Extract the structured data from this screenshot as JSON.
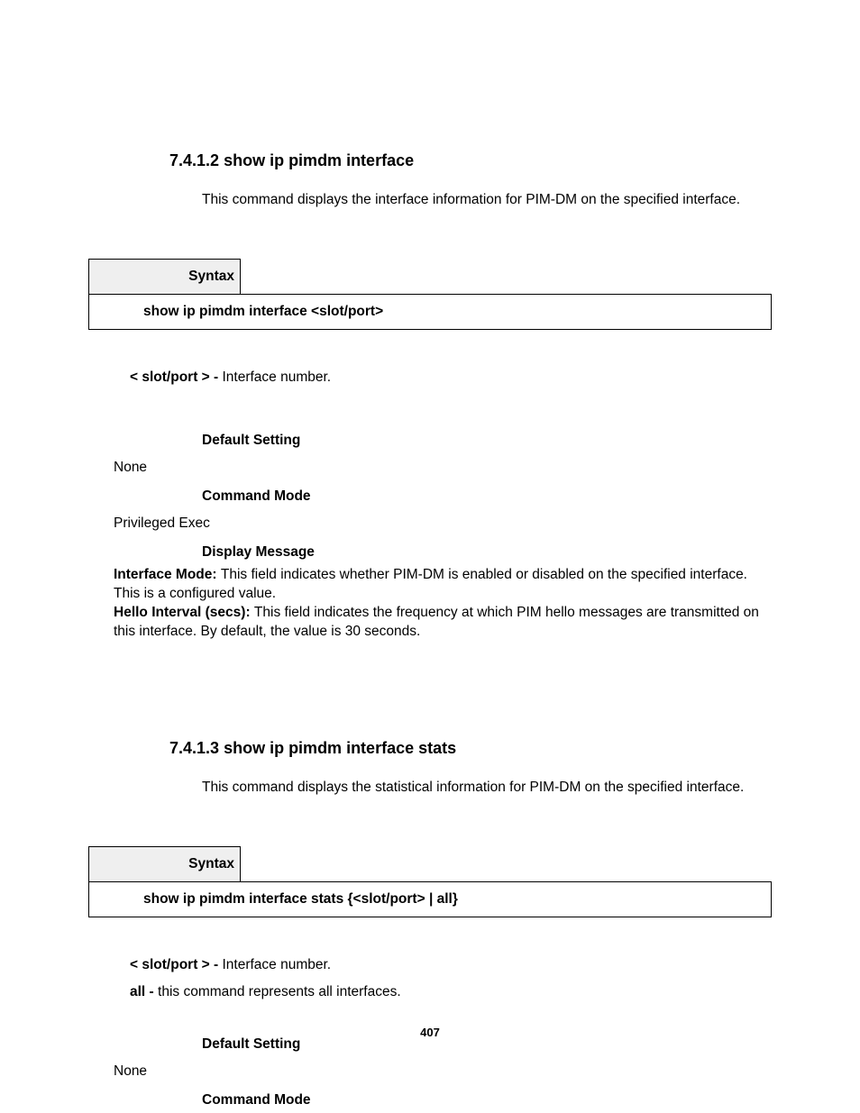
{
  "section1": {
    "number": "7.4.1.2",
    "title": "show ip pimdm interface",
    "intro": "This command displays the interface information for PIM-DM on the specified interface.",
    "syntax_label": "Syntax",
    "syntax_body": "show ip pimdm interface <slot/port>",
    "param_label": "< slot/port > - ",
    "param_desc": "Interface number.",
    "default_label": "Default Setting",
    "default_value": "None",
    "mode_label": "Command Mode",
    "mode_value": "Privileged Exec",
    "display_label": "Display Message",
    "field1_label": "Interface Mode: ",
    "field1_text": "This field indicates whether PIM-DM is enabled or disabled on the specified interface. This is a configured value.",
    "field2_label": "Hello Interval (secs): ",
    "field2_text": "This field indicates the frequency at which PIM hello messages are transmitted on this interface. By default, the value is 30 seconds."
  },
  "section2": {
    "number": "7.4.1.3",
    "title": "show ip pimdm interface stats",
    "intro": "This command displays the statistical information for PIM-DM on the specified interface.",
    "syntax_label": "Syntax",
    "syntax_body": "show ip pimdm interface stats {<slot/port> | all}",
    "param1_label": "< slot/port > - ",
    "param1_desc": "Interface number.",
    "param2_label": "all - ",
    "param2_desc": "this command represents all interfaces.",
    "default_label": "Default Setting",
    "default_value": "None",
    "mode_label": "Command Mode"
  },
  "page_number": "407"
}
